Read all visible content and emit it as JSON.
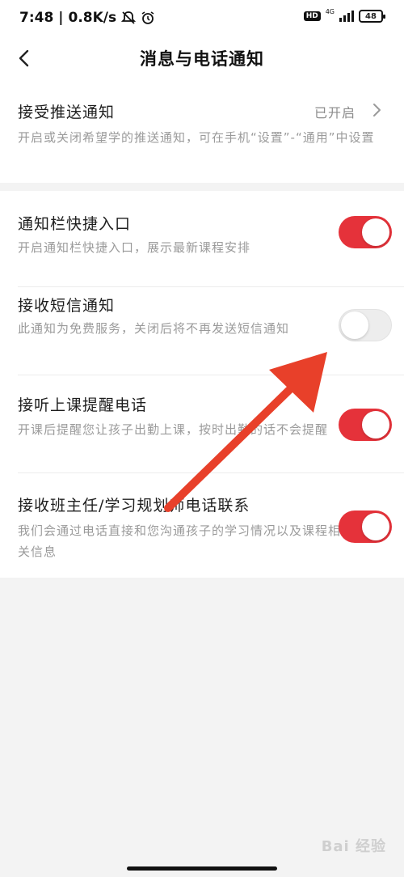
{
  "status_bar": {
    "time": "7:48",
    "speed": "0.8K/s",
    "hd": "HD",
    "network": "4G",
    "battery": "48",
    "icons": [
      "mute-icon",
      "alarm-icon",
      "signal-icon",
      "battery-icon"
    ]
  },
  "header": {
    "title": "消息与电话通知",
    "back_icon": "chevron-left-icon"
  },
  "push": {
    "title": "接受推送通知",
    "status": "已开启",
    "desc": "开启或关闭希望学的推送通知，可在手机“设置”-“通用”中设置"
  },
  "settings": [
    {
      "title": "通知栏快捷入口",
      "desc": "开启通知栏快捷入口，展示最新课程安排",
      "enabled": true
    },
    {
      "title": "接收短信通知",
      "desc": "此通知为免费服务，关闭后将不再发送短信通知",
      "enabled": false
    },
    {
      "title": "接听上课提醒电话",
      "desc": "开课后提醒您让孩子出勤上课，按时出勤的话不会提醒",
      "enabled": true
    },
    {
      "title": "接收班主任/学习规划师电话联系",
      "desc": "我们会通过电话直接和您沟通孩子的学习情况以及课程相关信息",
      "enabled": true
    }
  ],
  "watermark": "Bai 经验",
  "colors": {
    "accent": "#e5323a",
    "annotation_arrow": "#e8402a",
    "toggle_off": "#ededed"
  }
}
